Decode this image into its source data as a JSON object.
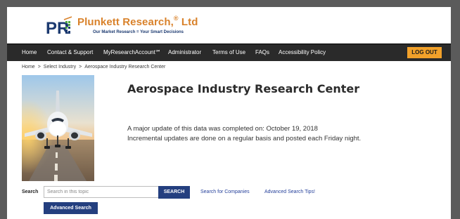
{
  "brand": {
    "mark": "PR",
    "name": "Plunkett Research,",
    "registered": "®",
    "suffix": " Ltd",
    "tagline": "Our Market Research = Your Smart Decisions",
    "colors": {
      "orange": "#d9822b",
      "navy": "#1c3a70",
      "green": "#4fa83d"
    }
  },
  "nav": {
    "items": [
      {
        "label": "Home"
      },
      {
        "label": "Contact & Support"
      },
      {
        "label": "MyResearchAccount℠"
      },
      {
        "label": "Administrator"
      },
      {
        "label": "Terms of Use"
      },
      {
        "label": "FAQs"
      },
      {
        "label": "Accessibility Policy"
      }
    ],
    "logout_label": "LOG OUT",
    "colors": {
      "bar": "#2a2a2a",
      "logout": "#f2a12a"
    }
  },
  "breadcrumb": {
    "items": [
      "Home",
      "Select Industry",
      "Aerospace Industry Research Center"
    ],
    "separator": ">"
  },
  "hero": {
    "icon": "airplane-photo"
  },
  "main": {
    "title": "Aerospace Industry Research Center",
    "update_line_1": "A major update of this data was completed on: October 19, 2018",
    "update_line_2": "Incremental updates are done on a regular basis and posted each Friday night."
  },
  "search": {
    "label": "Search",
    "placeholder": "Search in this topic",
    "button_label": "SEARCH",
    "companies_link": "Search for Companies",
    "tips_link": "Advanced Search Tips!",
    "advanced_button_label": "Advanced Search",
    "colors": {
      "button": "#243f7f",
      "link": "#243f9a"
    }
  }
}
